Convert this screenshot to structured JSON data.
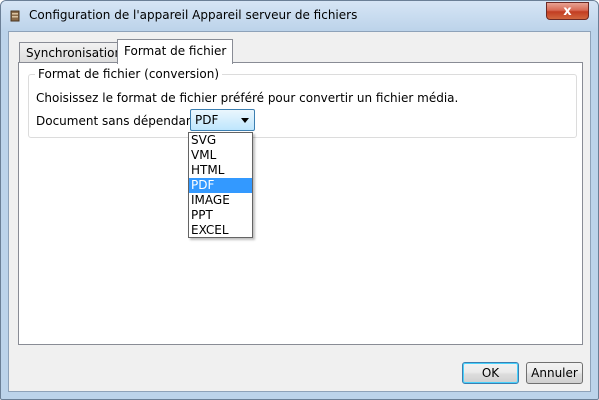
{
  "window": {
    "title": "Configuration de l'appareil Appareil serveur de fichiers",
    "close_label": "x"
  },
  "tabs": [
    {
      "label": "Synchronisation",
      "active": false
    },
    {
      "label": "Format de fichier",
      "active": true
    }
  ],
  "group": {
    "label": "Format de fichier (conversion)",
    "instruction": "Choisissez le format de fichier préféré pour convertir un fichier média."
  },
  "document_field": {
    "label": "Document sans dépendance",
    "selected": "PDF",
    "options": [
      "SVG",
      "VML",
      "HTML",
      "PDF",
      "IMAGE",
      "PPT",
      "EXCEL"
    ]
  },
  "buttons": {
    "ok": "OK",
    "cancel": "Annuler"
  },
  "colors": {
    "selection": "#3399ff",
    "close": "#c23d22",
    "frame": "#bcd3ea"
  }
}
